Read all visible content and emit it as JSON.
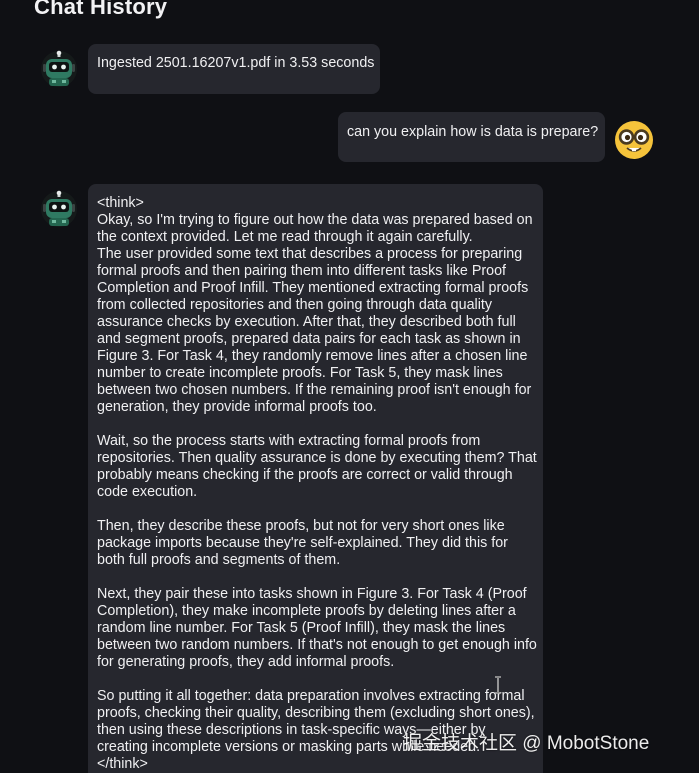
{
  "page": {
    "title": "Chat History"
  },
  "messages": [
    {
      "role": "assistant",
      "avatar_icon": "robot-icon",
      "text": "Ingested 2501.16207v1.pdf in 3.53 seconds"
    },
    {
      "role": "user",
      "avatar_icon": "nerd-face-emoji-icon",
      "text": "can you explain how is data is prepare?"
    },
    {
      "role": "assistant",
      "avatar_icon": "robot-icon",
      "text": "<think>\nOkay, so I'm trying to figure out how the data was prepared based on the context provided. Let me read through it again carefully.\nThe user provided some text that describes a process for preparing formal proofs and then pairing them into different tasks like Proof Completion and Proof Infill. They mentioned extracting formal proofs from collected repositories and then going through data quality assurance checks by execution. After that, they described both full and segment proofs, prepared data pairs for each task as shown in Figure 3. For Task 4, they randomly remove lines after a chosen line number to create incomplete proofs. For Task 5, they mask lines between two chosen numbers. If the remaining proof isn't enough for generation, they provide informal proofs too.\n\nWait, so the process starts with extracting formal proofs from repositories. Then quality assurance is done by executing them? That probably means checking if the proofs are correct or valid through code execution.\n\nThen, they describe these proofs, but not for very short ones like package imports because they're self-explained. They did this for both full proofs and segments of them.\n\nNext, they pair these into tasks shown in Figure 3. For Task 4 (Proof Completion), they make incomplete proofs by deleting lines after a random line number. For Task 5 (Proof Infill), they mask the lines between two random numbers. If that's not enough to get enough info for generating proofs, they add informal proofs.\n\nSo putting it all together: data preparation involves extracting formal proofs, checking their quality, describing them (excluding short ones), then using these descriptions in task-specific ways—either by creating incomplete versions or masking parts while needed.\n</think>"
    }
  ],
  "watermark": {
    "text": "掘金技术社区 @ MobotStone"
  },
  "colors": {
    "background": "#0f1014",
    "bubble": "#26272e",
    "text": "#f0f0f2",
    "robot_body": "#2f7a62",
    "emoji_face": "#f5c33b"
  }
}
